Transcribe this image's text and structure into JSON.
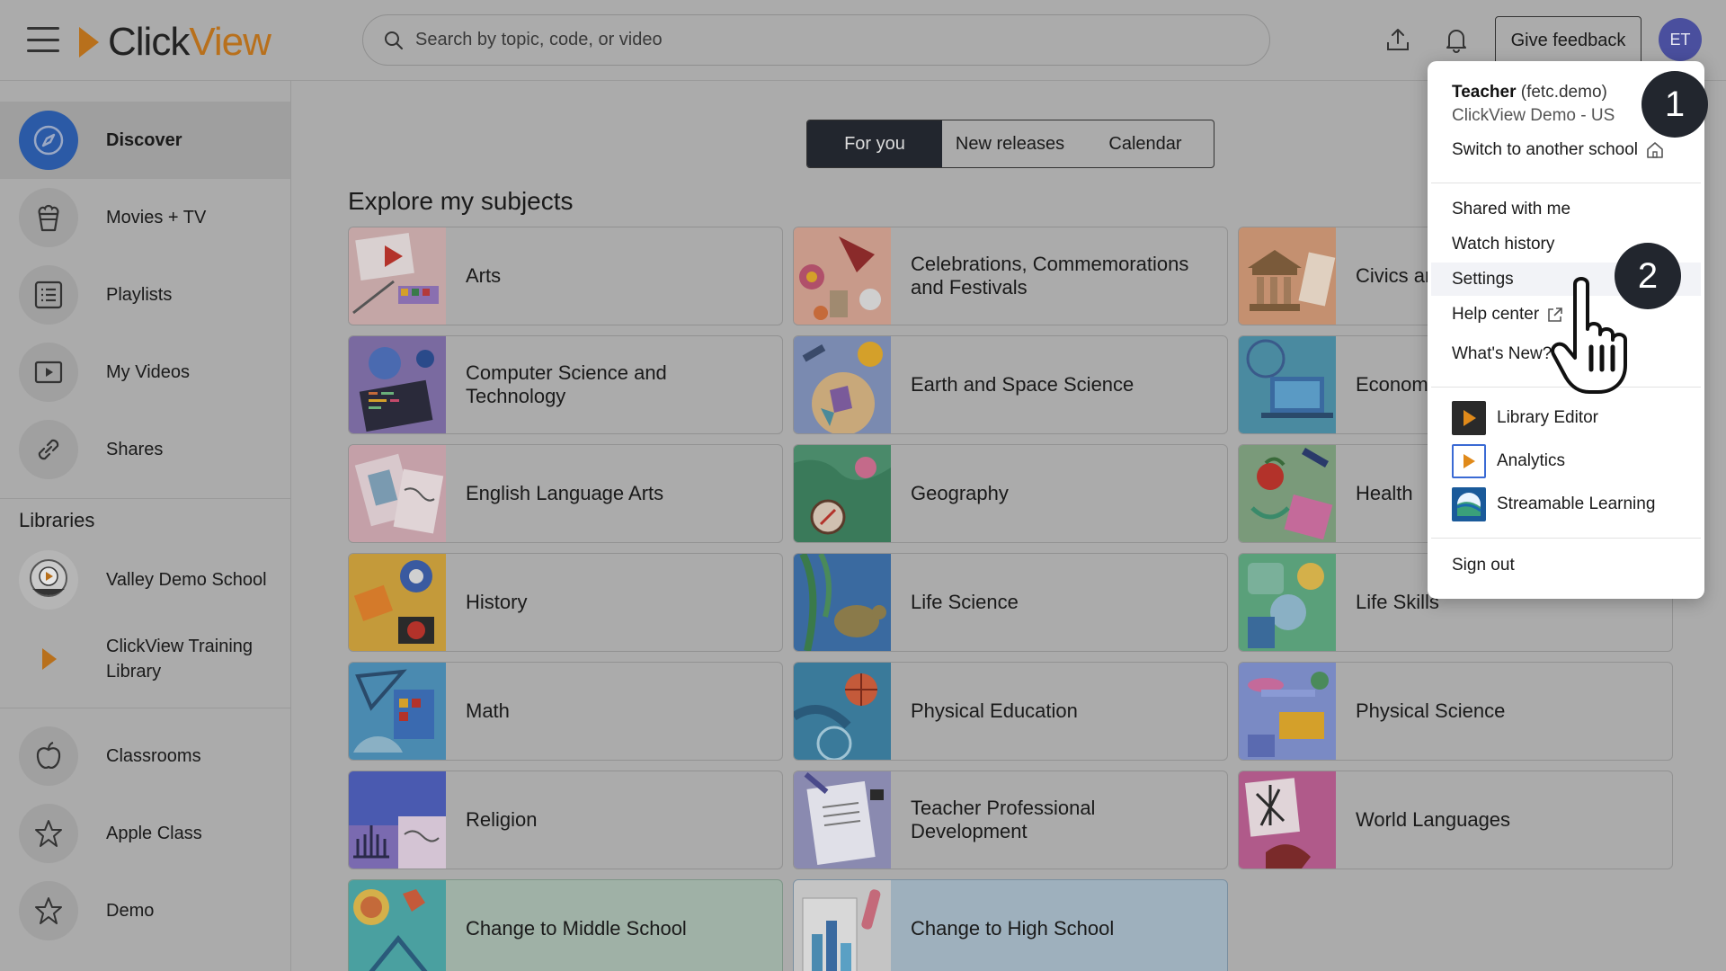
{
  "app": {
    "logo_text_a": "Click",
    "logo_text_b": "View",
    "search_placeholder": "Search by topic, code, or video",
    "feedback_label": "Give feedback",
    "avatar_initials": "ET"
  },
  "sidebar": {
    "items": [
      {
        "label": "Discover",
        "icon": "compass-icon"
      },
      {
        "label": "Movies + TV",
        "icon": "popcorn-icon"
      },
      {
        "label": "Playlists",
        "icon": "list-icon"
      },
      {
        "label": "My Videos",
        "icon": "play-box-icon"
      },
      {
        "label": "Shares",
        "icon": "link-icon"
      }
    ],
    "libraries_title": "Libraries",
    "libraries": [
      {
        "label": "Valley Demo School",
        "icon": "school-crest-icon"
      },
      {
        "label": "ClickView Training Library",
        "icon": "clickview-play-icon"
      }
    ],
    "classes": [
      {
        "label": "Classrooms",
        "icon": "apple-icon"
      },
      {
        "label": "Apple Class",
        "icon": "star-icon"
      },
      {
        "label": "Demo",
        "icon": "star-icon"
      }
    ]
  },
  "tabs": [
    "For you",
    "New releases",
    "Calendar"
  ],
  "section_heading": "Explore my subjects",
  "subjects": [
    "Arts",
    "Celebrations, Commemorations and Festivals",
    "Civics and Government",
    "Computer Science and Technology",
    "Earth and Space Science",
    "Economics",
    "English Language Arts",
    "Geography",
    "Health",
    "History",
    "Life Science",
    "Life Skills",
    "Math",
    "Physical Education",
    "Physical Science",
    "Religion",
    "Teacher Professional Development",
    "World Languages",
    "Change to Middle School",
    "Change to High School"
  ],
  "subject_visible_labels": [
    "Arts",
    "Celebrations, Commemorations and Festivals",
    "Civics ar",
    "Computer Science and Technology",
    "Earth and Space Science",
    "Economi",
    "English Language Arts",
    "Geography",
    "Health",
    "History",
    "Life Science",
    "Life Skills",
    "Math",
    "Physical Education",
    "Physical Science",
    "Religion",
    "Teacher Professional Development",
    "World Languages",
    "Change to Middle School",
    "Change to High School"
  ],
  "dropdown": {
    "role": "Teacher",
    "username": "(fetc.demo)",
    "school": "ClickView Demo - US",
    "switch_school": "Switch to another school",
    "shared": "Shared with me",
    "history": "Watch history",
    "settings": "Settings",
    "help": "Help center",
    "whats_new": "What's New?",
    "apps": [
      "Library Editor",
      "Analytics",
      "Streamable Learning"
    ],
    "sign_out": "Sign out"
  },
  "annotations": {
    "step1": "1",
    "step2": "2"
  },
  "colors": {
    "brand_orange": "#b8701c",
    "discover_blue": "#2b5aa6",
    "avatar": "#4a4f9e",
    "tab_active": "#22262e"
  }
}
